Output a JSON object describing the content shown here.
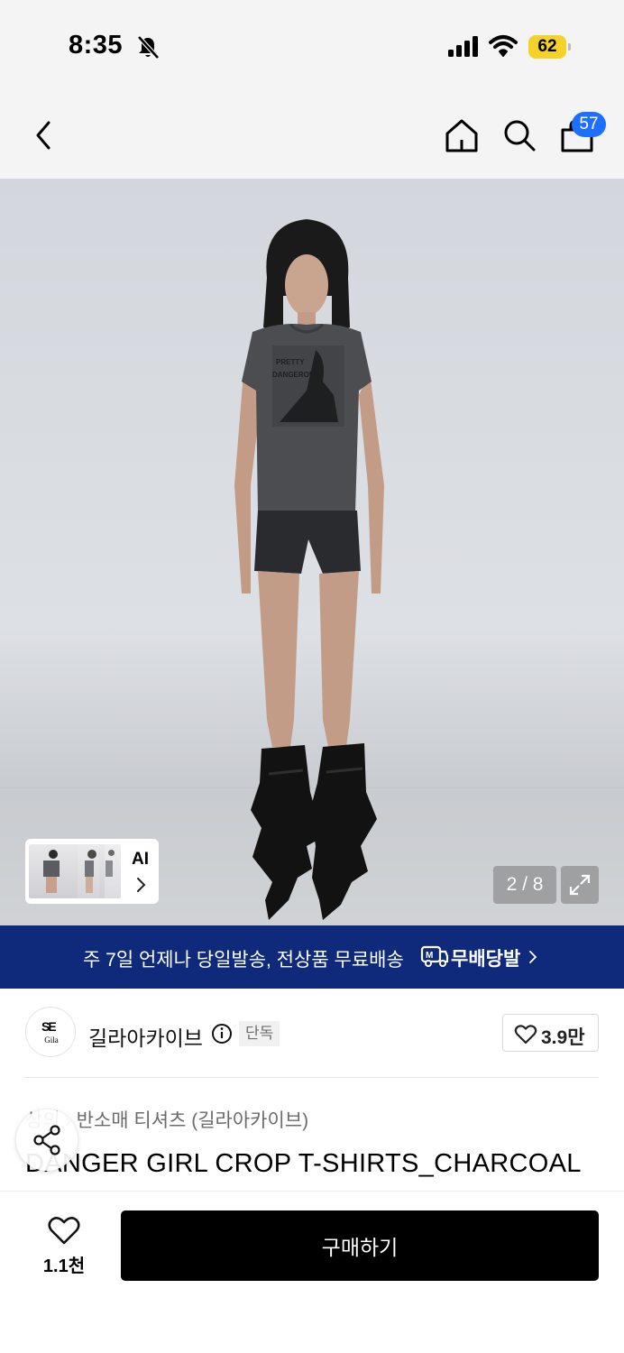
{
  "status_bar": {
    "time": "8:35",
    "battery": "62",
    "icons": [
      "bell-slash-icon",
      "cellular-signal-icon",
      "wifi-icon",
      "battery-icon"
    ]
  },
  "nav": {
    "icons": [
      "chevron-left-icon",
      "home-icon",
      "search-icon",
      "shopping-bag-icon"
    ],
    "cart_count": "57"
  },
  "gallery": {
    "thumbnail_label": "AI",
    "counter": "2 / 8",
    "expand_icon": "expand-icon"
  },
  "promo": {
    "text": "주 7일 언제나 당일발송, 전상품 무료배송",
    "brand": "무배당발",
    "background": "#0f2a7a"
  },
  "brand": {
    "logo_mark": "SE",
    "logo_sub": "Gila",
    "name": "길라아카이브",
    "badge": "단독",
    "likes": "3.9만"
  },
  "breadcrumb": {
    "items": [
      "상의",
      "반소매 티셔츠 (길라아카이브)"
    ]
  },
  "product": {
    "title": "DANGER GIRL CROP T-SHIRTS_CHARCOAL"
  },
  "bottom_bar": {
    "wish_count": "1.1천",
    "buy_label": "구매하기"
  }
}
